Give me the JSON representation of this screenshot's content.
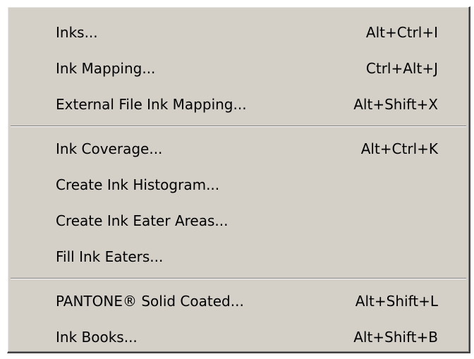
{
  "menu": {
    "groups": [
      {
        "items": [
          {
            "label": "Inks...",
            "shortcut": "Alt+Ctrl+I"
          },
          {
            "label": "Ink Mapping...",
            "shortcut": "Ctrl+Alt+J"
          },
          {
            "label": "External File Ink Mapping...",
            "shortcut": "Alt+Shift+X"
          }
        ]
      },
      {
        "items": [
          {
            "label": "Ink Coverage...",
            "shortcut": "Alt+Ctrl+K"
          },
          {
            "label": "Create Ink Histogram...",
            "shortcut": ""
          },
          {
            "label": "Create Ink Eater Areas...",
            "shortcut": ""
          },
          {
            "label": "Fill Ink Eaters...",
            "shortcut": ""
          }
        ]
      },
      {
        "items": [
          {
            "label": "PANTONE® Solid Coated...",
            "shortcut": "Alt+Shift+L"
          },
          {
            "label": "Ink Books...",
            "shortcut": "Alt+Shift+B"
          }
        ]
      }
    ]
  }
}
